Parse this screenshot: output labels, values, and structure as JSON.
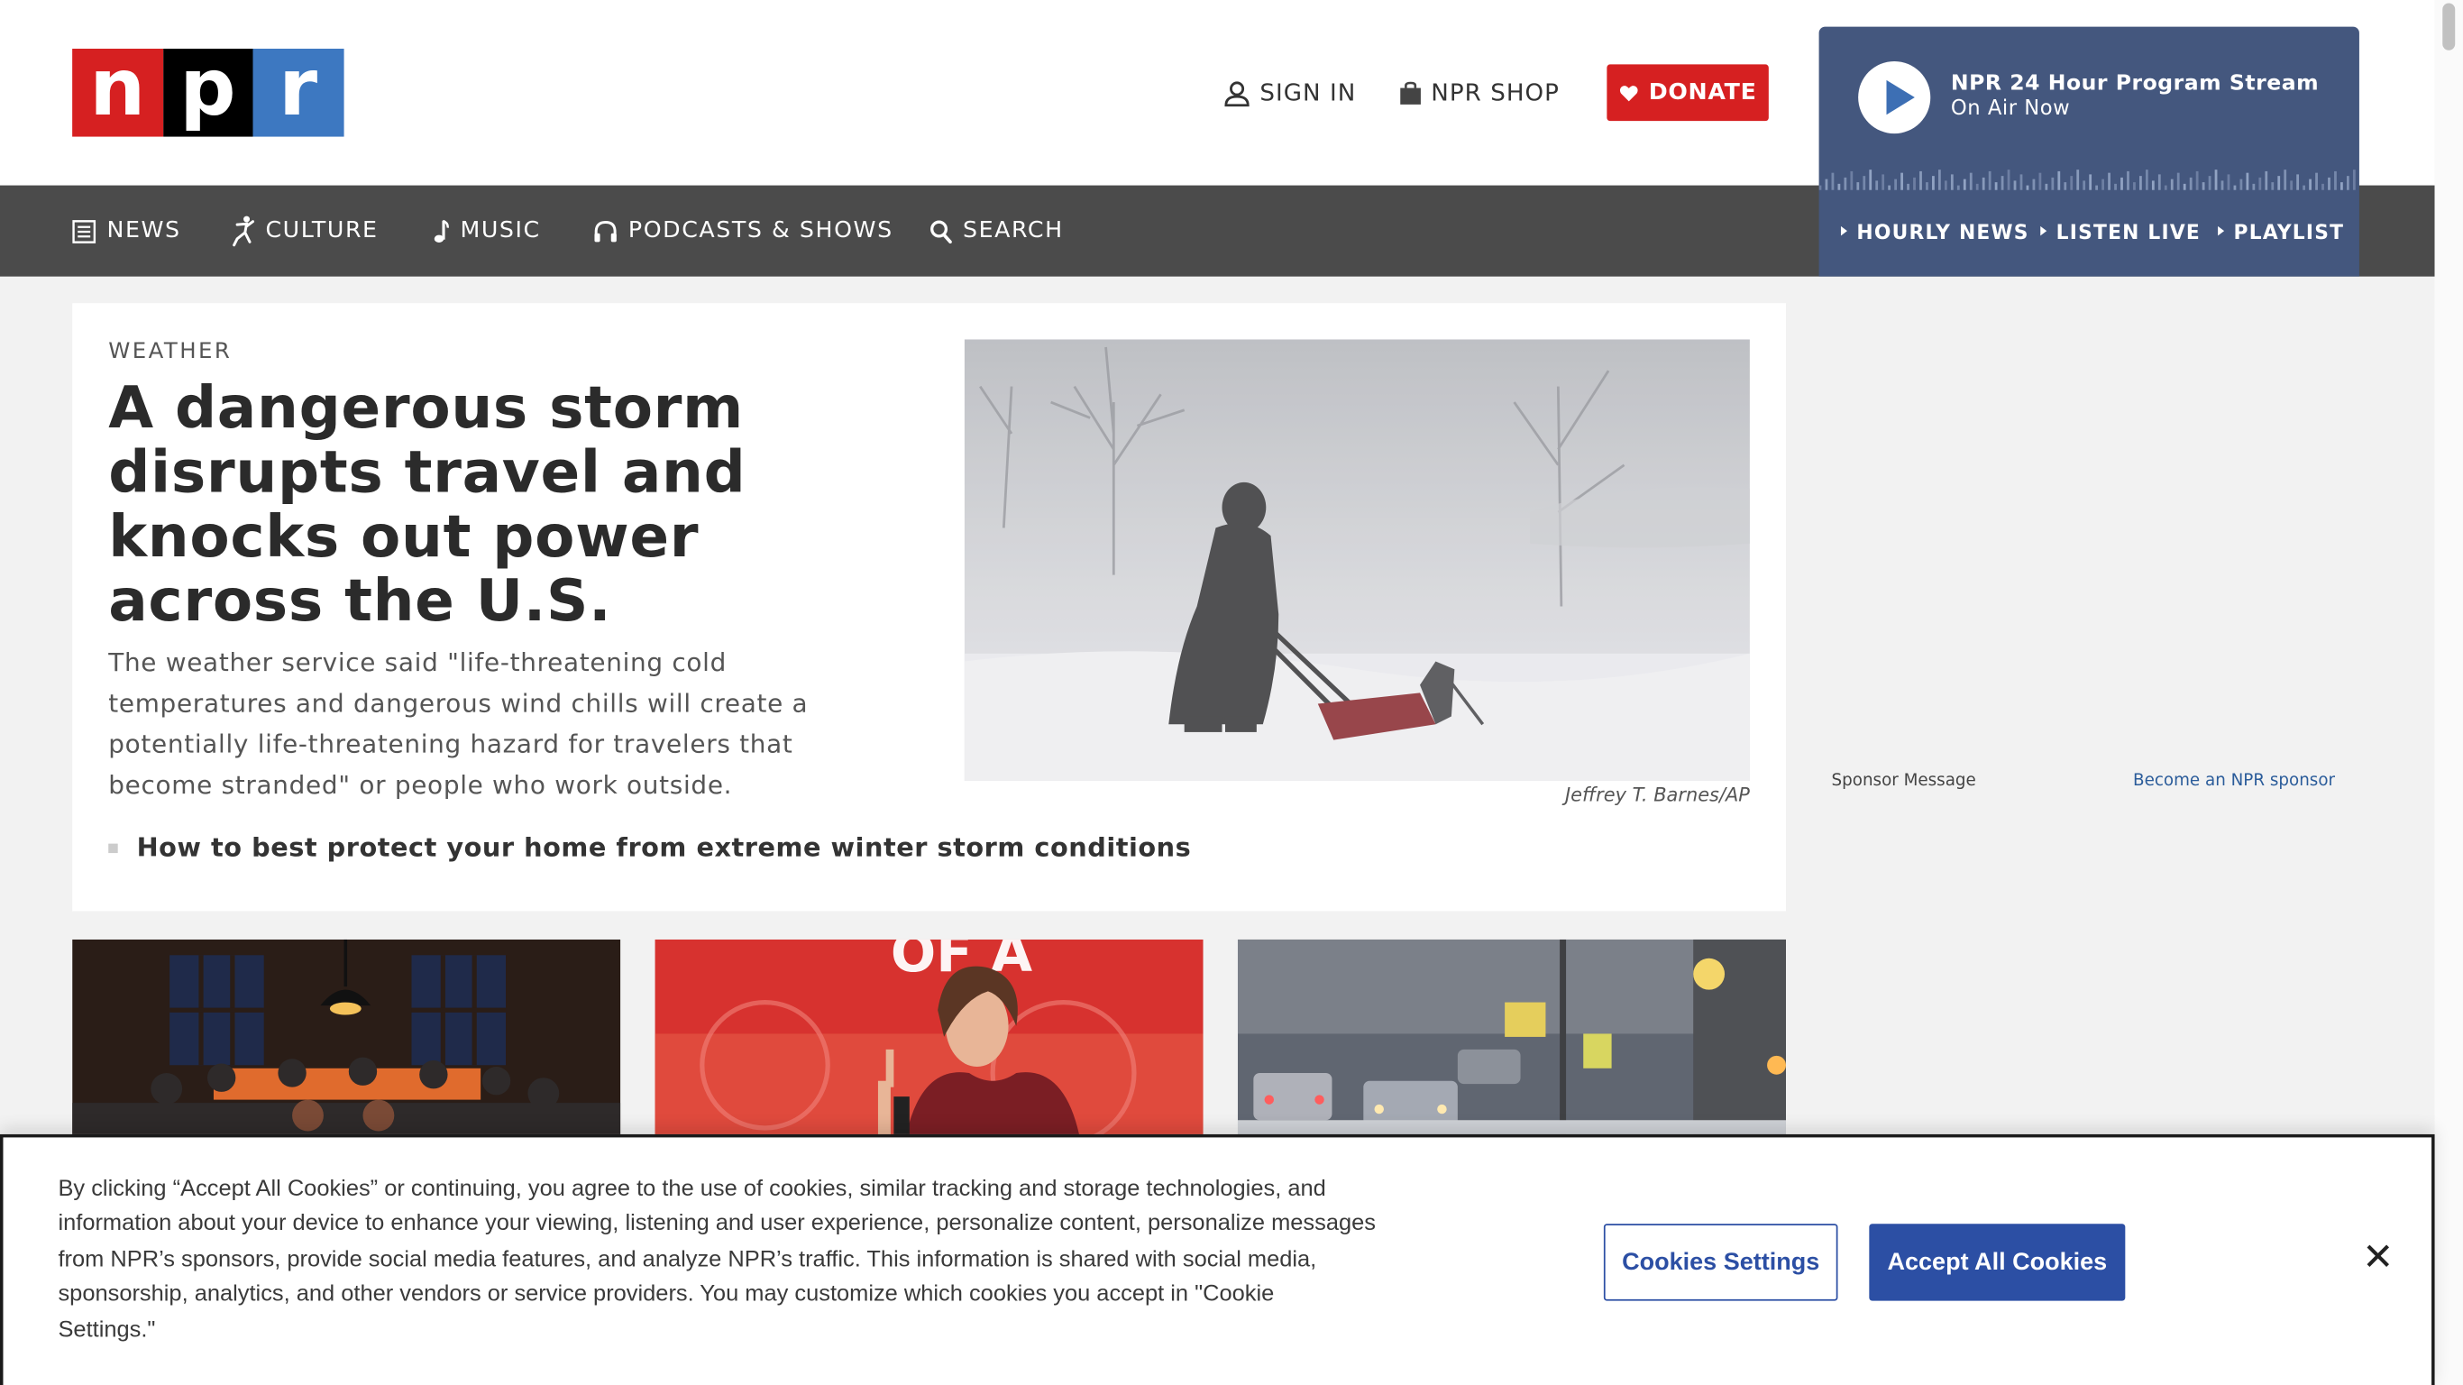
{
  "brand": {
    "letters": [
      "n",
      "p",
      "r"
    ],
    "red": "#d62021",
    "black": "#000000",
    "blue": "#3d78c1"
  },
  "header": {
    "sign_in": "SIGN IN",
    "shop": "NPR SHOP",
    "donate": "DONATE"
  },
  "nav": {
    "items": [
      {
        "label": "NEWS",
        "icon": "news-icon"
      },
      {
        "label": "CULTURE",
        "icon": "culture-icon"
      },
      {
        "label": "MUSIC",
        "icon": "music-note-icon"
      },
      {
        "label": "PODCASTS & SHOWS",
        "icon": "headphones-icon"
      },
      {
        "label": "SEARCH",
        "icon": "search-icon"
      }
    ],
    "background": "#4b4b4b"
  },
  "player": {
    "title": "NPR 24 Hour Program Stream",
    "subtitle": "On Air Now",
    "links": [
      "HOURLY NEWS",
      "LISTEN LIVE",
      "PLAYLIST"
    ],
    "background": "#44577e"
  },
  "story": {
    "kicker": "WEATHER",
    "headline": "A dangerous storm disrupts travel and knocks out power across the U.S.",
    "teaser": "The weather service said \"life-threatening cold temperatures and dangerous wind chills will create a potentially life-threatening hazard for travelers that become stranded\" or people who work outside.",
    "image_credit": "Jeffrey T. Barnes/AP",
    "related": "How to best protect your home from extreme winter storm conditions"
  },
  "sponsor": {
    "label": "Sponsor Message",
    "link": "Become an NPR sponsor"
  },
  "cookie_banner": {
    "text": "By clicking “Accept All Cookies” or continuing, you agree to the use of cookies, similar tracking and storage technologies, and information about your device to enhance your viewing, listening and user experience, personalize content, personalize messages from NPR’s sponsors, provide social media features, and analyze NPR’s traffic. This information is shared with social media, sponsorship, analytics, and other vendors or service providers. You may customize which cookies you accept in \"Cookie Settings.\"",
    "settings_button": "Cookies Settings",
    "accept_button": "Accept All Cookies",
    "accent": "#2c4fa4"
  }
}
